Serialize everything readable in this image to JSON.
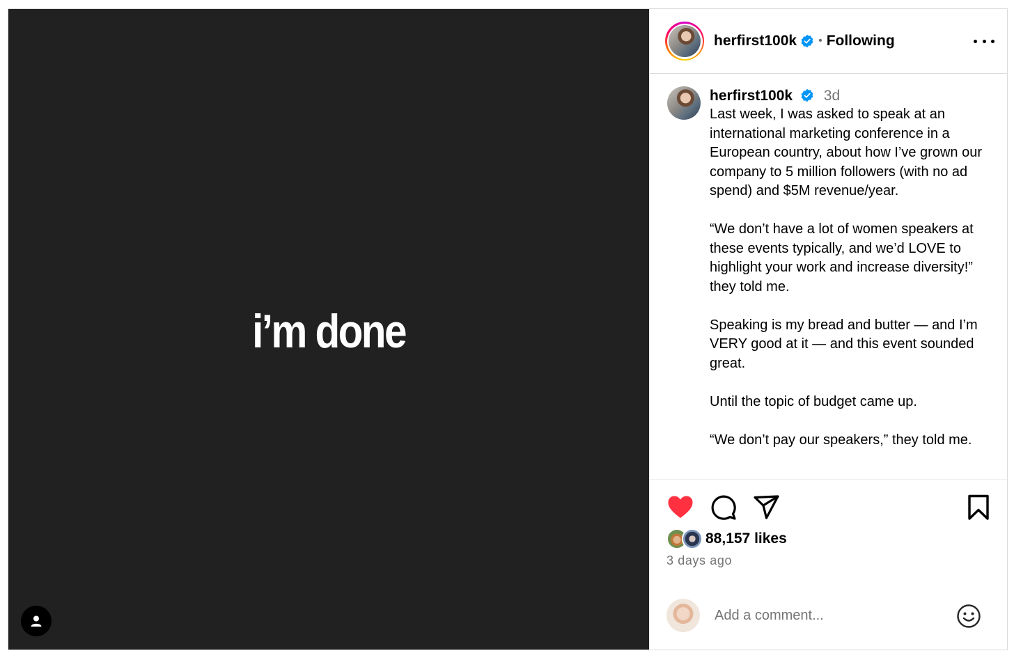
{
  "media": {
    "overlay_text": "i’m done",
    "background_color": "#212121",
    "tag_icon": "user-icon"
  },
  "header": {
    "username": "herfirst100k",
    "separator": "•",
    "follow_status": "Following",
    "more_icon": "ellipsis-icon",
    "verified_color": "#0095f6"
  },
  "caption": {
    "username": "herfirst100k",
    "time": "3d",
    "paragraphs": [
      "Last week, I was asked to speak at an international marketing conference in a European country, about how I’ve grown our company to 5 million followers (with no ad spend) and $5M revenue/year.",
      "“We don’t have a lot of women speakers at these events typically, and we’d LOVE to highlight your work and increase diversity!” they told me.",
      "Speaking is my bread and butter — and I’m VERY good at it — and this event sounded great.",
      "Until the topic of budget came up.",
      "“We don’t pay our speakers,” they told me."
    ]
  },
  "actions": {
    "like_icon": "heart-icon",
    "like_color": "#ff3040",
    "comment_icon": "comment-icon",
    "share_icon": "paper-plane-icon",
    "save_icon": "bookmark-icon"
  },
  "likes": {
    "count_text": "88,157 likes"
  },
  "post_date": "3 days ago",
  "comment": {
    "placeholder": "Add a comment...",
    "emoji_icon": "smiley-icon"
  }
}
